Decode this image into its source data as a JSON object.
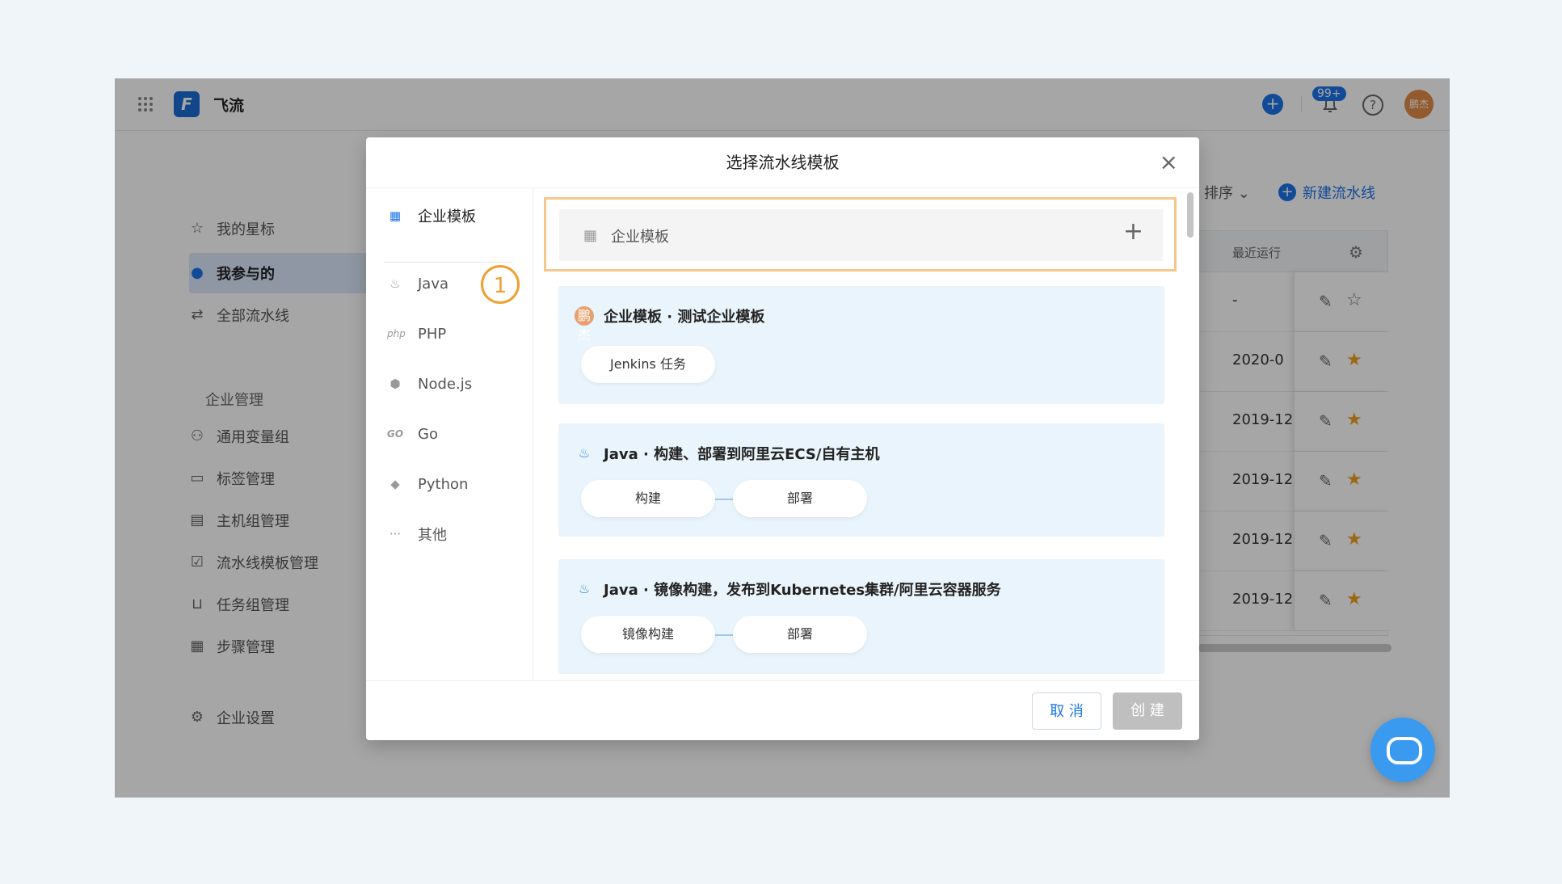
{
  "app": {
    "name": "飞流",
    "logo_letter": "F",
    "notification_badge": "99+",
    "avatar_text": "鹏杰",
    "help_glyph": "?"
  },
  "sidebar": {
    "items": [
      {
        "label": "我的星标",
        "icon": "star-outline-icon"
      },
      {
        "label": "我参与的",
        "icon": "user-icon"
      },
      {
        "label": "全部流水线",
        "icon": "swap-icon"
      }
    ],
    "section_title": "企业管理",
    "manage_items": [
      {
        "label": "通用变量组",
        "icon": "variables-icon"
      },
      {
        "label": "标签管理",
        "icon": "tag-icon"
      },
      {
        "label": "主机组管理",
        "icon": "host-icon"
      },
      {
        "label": "流水线模板管理",
        "icon": "template-icon"
      },
      {
        "label": "任务组管理",
        "icon": "inbox-icon"
      },
      {
        "label": "步骤管理",
        "icon": "steps-icon"
      }
    ],
    "settings_label": "企业设置"
  },
  "main": {
    "sort_label": "排序",
    "new_pipeline_label": "新建流水线",
    "table": {
      "column_label": "最近运行",
      "rows": [
        {
          "date": "-",
          "starred": false
        },
        {
          "date": "2020-0",
          "starred": true
        },
        {
          "date": "2019-12",
          "starred": true
        },
        {
          "date": "2019-12",
          "starred": true
        },
        {
          "date": "2019-12",
          "starred": true
        },
        {
          "date": "2019-12",
          "starred": true
        }
      ]
    }
  },
  "modal": {
    "title": "选择流水线模板",
    "categories": [
      {
        "label": "企业模板",
        "icon": "grid-icon",
        "active": true
      },
      {
        "label": "Java",
        "icon": "java-icon"
      },
      {
        "label": "PHP",
        "icon": "php-icon"
      },
      {
        "label": "Node.js",
        "icon": "nodejs-icon"
      },
      {
        "label": "Go",
        "icon": "go-icon"
      },
      {
        "label": "Python",
        "icon": "python-icon"
      },
      {
        "label": "其他",
        "icon": "more-icon"
      }
    ],
    "step_badge": "1",
    "enterprise_header": "企业模板",
    "templates": [
      {
        "title": "企业模板 · 测试企业模板",
        "icon": "avatar-icon",
        "avatar_text": "鹏杰",
        "stages": [
          "Jenkins 任务"
        ]
      },
      {
        "title": "Java · 构建、部署到阿里云ECS/自有主机",
        "icon": "java-icon",
        "stages": [
          "构建",
          "部署"
        ]
      },
      {
        "title": "Java · 镜像构建，发布到Kubernetes集群/阿里云容器服务",
        "icon": "java-icon",
        "stages": [
          "镜像构建",
          "部署"
        ]
      }
    ],
    "cancel_label": "取 消",
    "create_label": "创 建"
  },
  "colors": {
    "accent": "#1b74e8",
    "highlight_border": "#f5c78a",
    "badge_orange": "#f0a030",
    "card_bg": "#eaf4fc",
    "star": "#f0a020"
  }
}
